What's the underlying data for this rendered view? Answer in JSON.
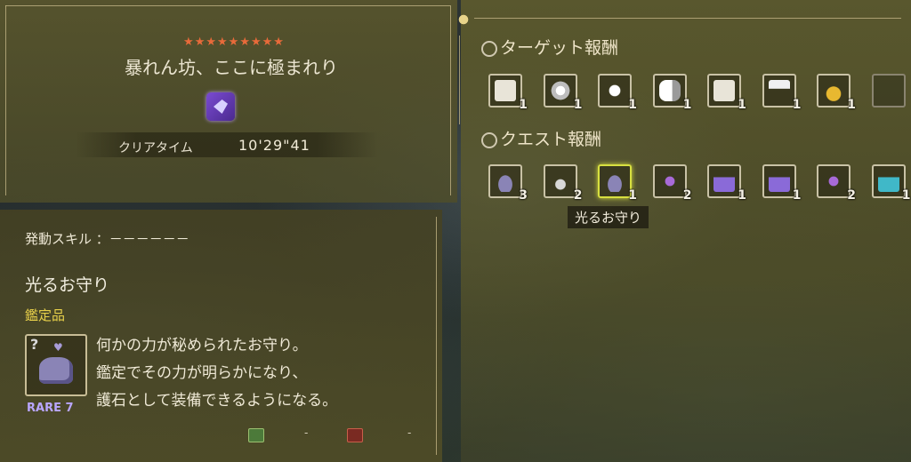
{
  "quest": {
    "stars": "★★★★★★★★★",
    "title": "暴れん坊、ここに極まれり",
    "clear_time_label": "クリアタイム",
    "clear_time_value": "10'29\"41"
  },
  "detail": {
    "skill_line": "発動スキル ：－－－－－－",
    "item_name": "光るお守り",
    "item_type": "鑑定品",
    "rarity": "RARE 7",
    "description": [
      "何かの力が秘められたお守り。",
      "鑑定でその力が明らかになり、",
      "護石として装備できるようになる。"
    ],
    "footer_dash_1": "-",
    "footer_dash_2": "-"
  },
  "rewards": {
    "target_title": "ターゲット報酬",
    "quest_title": "クエスト報酬",
    "tooltip": "光るお守り",
    "target_items": [
      {
        "icon": "scroll-icon",
        "count": "1"
      },
      {
        "icon": "scale-icon",
        "count": "1"
      },
      {
        "icon": "claw-icon",
        "count": "1"
      },
      {
        "icon": "tail-icon",
        "count": "1"
      },
      {
        "icon": "scroll-icon",
        "count": "1"
      },
      {
        "icon": "fang-icon",
        "count": "1"
      },
      {
        "icon": "gold-bag-icon",
        "count": "1"
      },
      {
        "icon": "empty-slot",
        "count": ""
      }
    ],
    "quest_items": [
      {
        "icon": "charm-rock-icon",
        "count": "3"
      },
      {
        "icon": "potion-icon",
        "count": "2"
      },
      {
        "icon": "charm-rock-icon",
        "count": "1"
      },
      {
        "icon": "gem-icon",
        "count": "2"
      },
      {
        "icon": "ingot-icon",
        "count": "1"
      },
      {
        "icon": "ingot-icon",
        "count": "1"
      },
      {
        "icon": "gem-icon",
        "count": "2"
      },
      {
        "icon": "ore-icon",
        "count": "1"
      }
    ]
  }
}
